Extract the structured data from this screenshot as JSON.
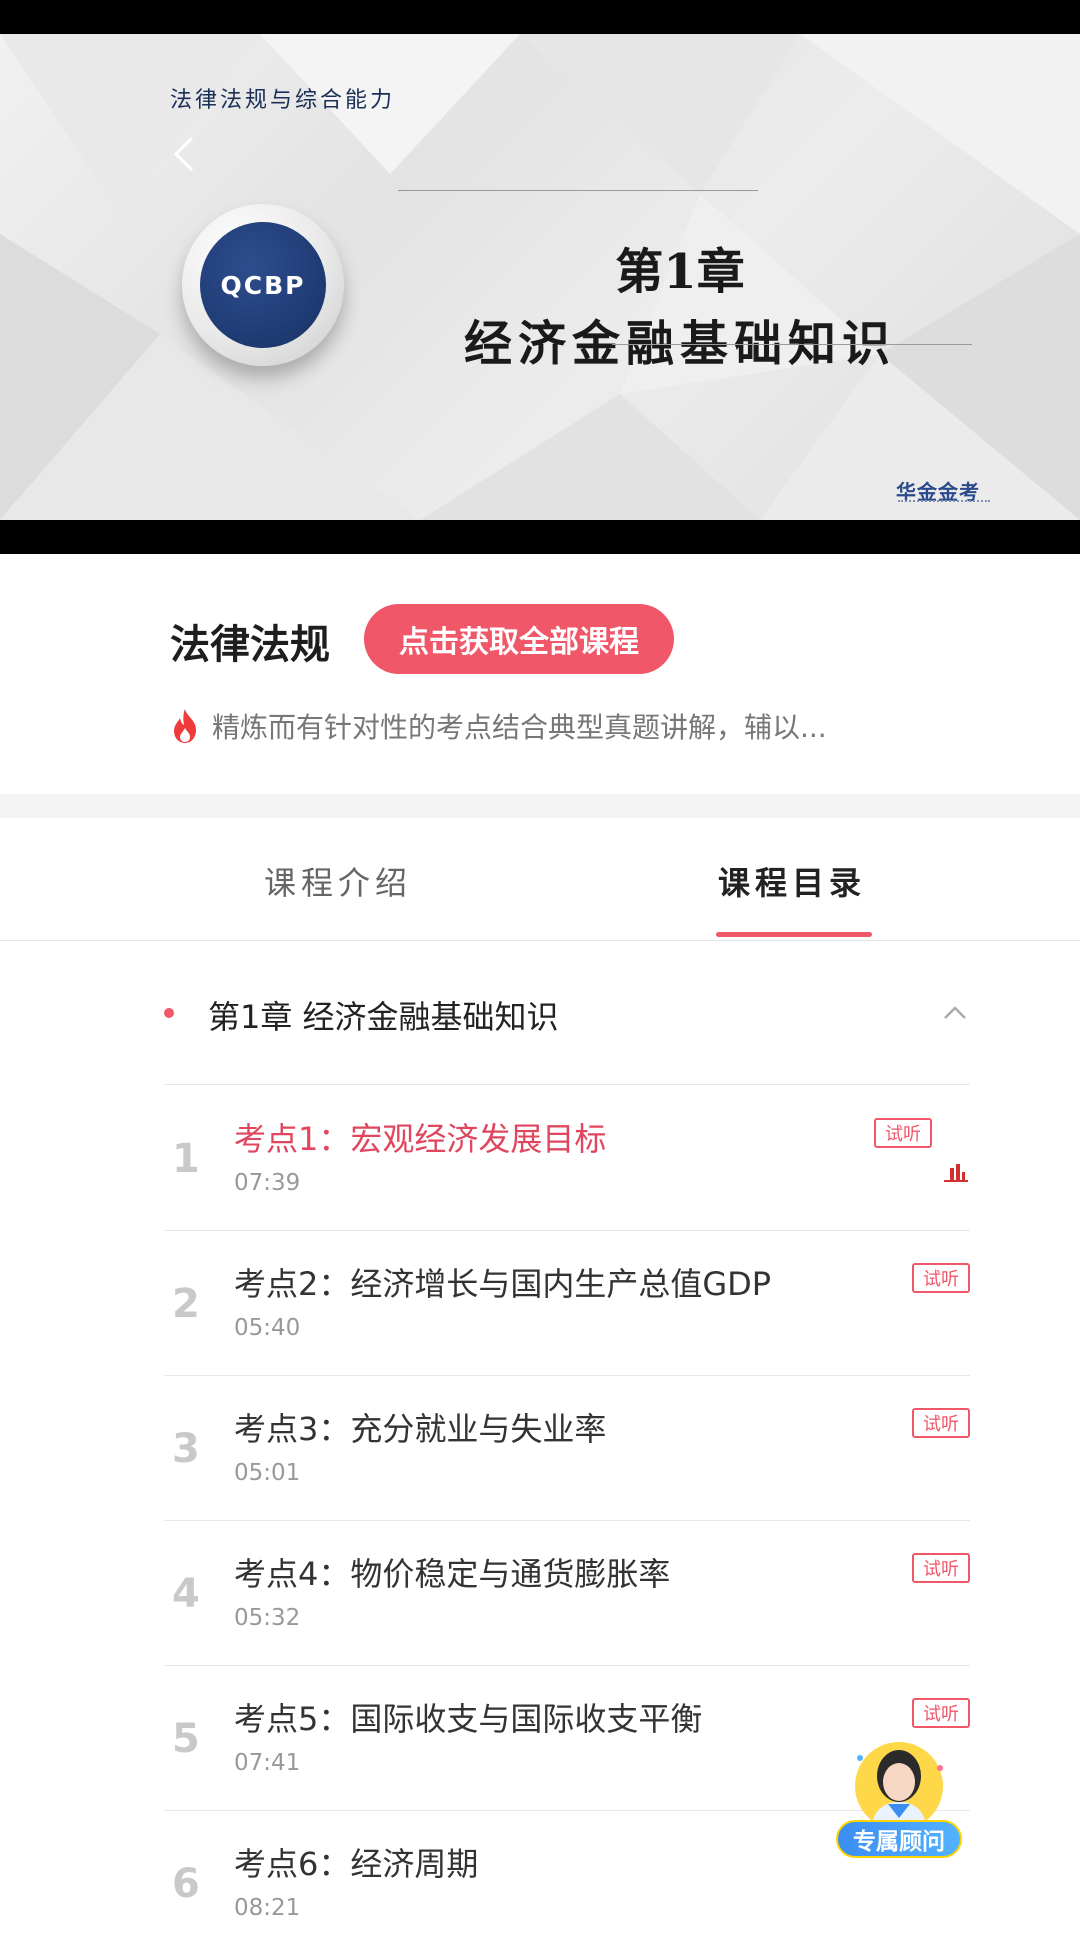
{
  "video": {
    "subtitle": "法律法规与综合能力",
    "logo_text": "QCBP",
    "chapter_num": "第1章",
    "chapter_title": "经济金融基础知识",
    "watermark": "华金金考"
  },
  "course": {
    "name": "法律法规",
    "cta_label": "点击获取全部课程",
    "description": "精炼而有针对性的考点结合典型真题讲解，辅以..."
  },
  "tabs": [
    {
      "label": "课程介绍",
      "active": false
    },
    {
      "label": "课程目录",
      "active": true
    }
  ],
  "chapter": {
    "label": "第1章 经济金融基础知识",
    "expanded": true
  },
  "lessons": [
    {
      "num": "1",
      "title": "考点1：宏观经济发展目标",
      "duration": "07:39",
      "tag": "试听",
      "active": true
    },
    {
      "num": "2",
      "title": "考点2：经济增长与国内生产总值GDP",
      "duration": "05:40",
      "tag": "试听",
      "active": false
    },
    {
      "num": "3",
      "title": "考点3：充分就业与失业率",
      "duration": "05:01",
      "tag": "试听",
      "active": false
    },
    {
      "num": "4",
      "title": "考点4：物价稳定与通货膨胀率",
      "duration": "05:32",
      "tag": "试听",
      "active": false
    },
    {
      "num": "5",
      "title": "考点5：国际收支与国际收支平衡",
      "duration": "07:41",
      "tag": "试听",
      "active": false
    },
    {
      "num": "6",
      "title": "考点6：经济周期",
      "duration": "08:21",
      "tag": "",
      "active": false
    }
  ],
  "advisor": {
    "label": "专属顾问"
  },
  "colors": {
    "accent": "#f05769",
    "active_title": "#e0475e",
    "logo_blue": "#203d77"
  }
}
